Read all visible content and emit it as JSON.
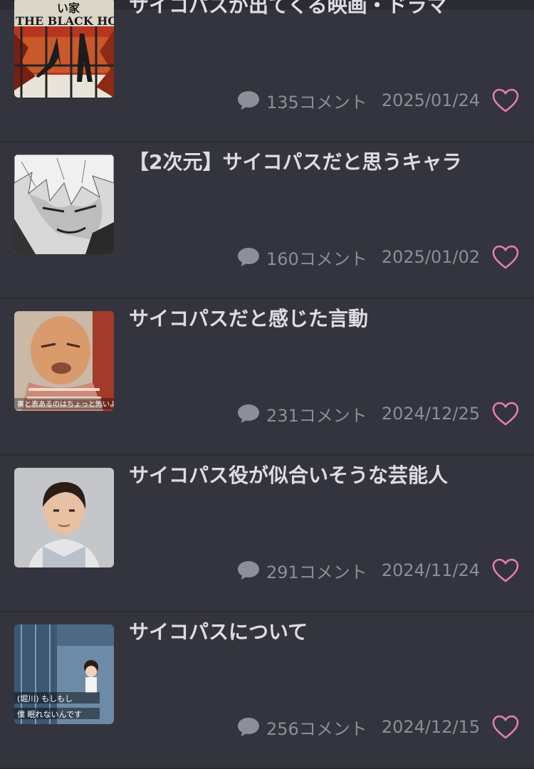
{
  "topics": [
    {
      "title": "サイコパスが出てくる映画・ドラマ",
      "comments": "135コメント",
      "date": "2025/01/24",
      "thumb_text": "THE BLACK HOUSE"
    },
    {
      "title": "【2次元】サイコパスだと思うキャラ",
      "comments": "160コメント",
      "date": "2025/01/02"
    },
    {
      "title": "サイコパスだと感じた言動",
      "comments": "231コメント",
      "date": "2024/12/25"
    },
    {
      "title": "サイコパス役が似合いそうな芸能人",
      "comments": "291コメント",
      "date": "2024/11/24"
    },
    {
      "title": "サイコパスについて",
      "comments": "256コメント",
      "date": "2024/12/15"
    }
  ],
  "colors": {
    "background": "#34343e",
    "title": "#dcdce2",
    "meta": "#8e8e98",
    "heart": "#e77fb0"
  },
  "icons": {
    "comment": "speech-bubble-icon",
    "like": "heart-outline-icon"
  }
}
